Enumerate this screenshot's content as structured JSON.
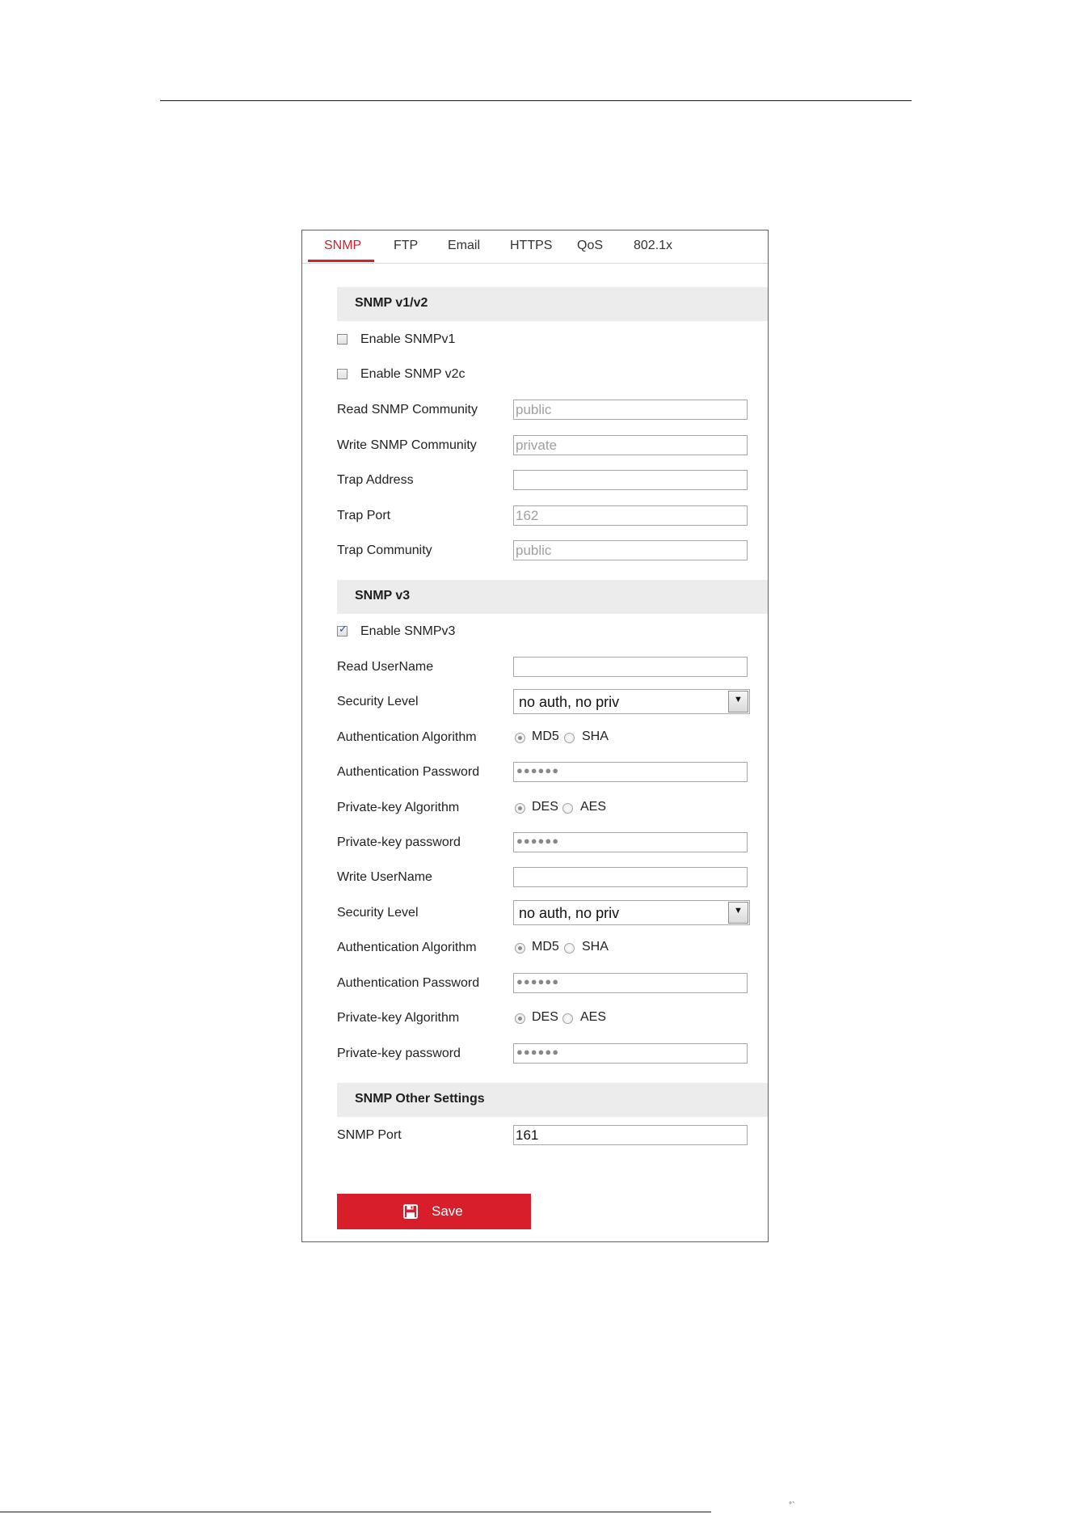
{
  "tabs": [
    {
      "label": "SNMP",
      "active": true
    },
    {
      "label": "FTP"
    },
    {
      "label": "Email"
    },
    {
      "label": "HTTPS"
    },
    {
      "label": "QoS"
    },
    {
      "label": "802.1x"
    }
  ],
  "v1v2": {
    "title": "SNMP v1/v2",
    "enable_v1": {
      "label": "Enable SNMPv1",
      "checked": false
    },
    "enable_v2c": {
      "label": "Enable SNMP v2c",
      "checked": false
    },
    "read_community": {
      "label": "Read SNMP Community",
      "value": "public"
    },
    "write_community": {
      "label": "Write SNMP Community",
      "value": "private"
    },
    "trap_address": {
      "label": "Trap Address",
      "value": ""
    },
    "trap_port": {
      "label": "Trap Port",
      "value": "162"
    },
    "trap_community": {
      "label": "Trap Community",
      "value": "public"
    }
  },
  "v3": {
    "title": "SNMP v3",
    "enable_v3": {
      "label": "Enable SNMPv3",
      "checked": true
    },
    "read_username": {
      "label": "Read UserName",
      "value": ""
    },
    "read_security_level": {
      "label": "Security Level",
      "value": "no auth, no priv"
    },
    "read_auth_algorithm": {
      "label": "Authentication Algorithm",
      "options": [
        "MD5",
        "SHA"
      ],
      "selected": "MD5"
    },
    "read_auth_password": {
      "label": "Authentication Password",
      "value": "●●●●●●"
    },
    "read_priv_algorithm": {
      "label": "Private-key Algorithm",
      "options": [
        "DES",
        "AES"
      ],
      "selected": "DES"
    },
    "read_priv_password": {
      "label": "Private-key password",
      "value": "●●●●●●"
    },
    "write_username": {
      "label": "Write UserName",
      "value": ""
    },
    "write_security_level": {
      "label": "Security Level",
      "value": "no auth, no priv"
    },
    "write_auth_algorithm": {
      "label": "Authentication Algorithm",
      "options": [
        "MD5",
        "SHA"
      ],
      "selected": "MD5"
    },
    "write_auth_password": {
      "label": "Authentication Password",
      "value": "●●●●●●"
    },
    "write_priv_algorithm": {
      "label": "Private-key Algorithm",
      "options": [
        "DES",
        "AES"
      ],
      "selected": "DES"
    },
    "write_priv_password": {
      "label": "Private-key password",
      "value": "●●●●●●"
    }
  },
  "other": {
    "title": "SNMP Other Settings",
    "snmp_port": {
      "label": "SNMP Port",
      "value": "161"
    }
  },
  "save": {
    "label": "Save"
  },
  "colors": {
    "accent": "#d81e2b",
    "section_bg": "#ececec"
  },
  "icons": {
    "save": "floppy-disk-icon",
    "dropdown": "chevron-down-icon"
  }
}
